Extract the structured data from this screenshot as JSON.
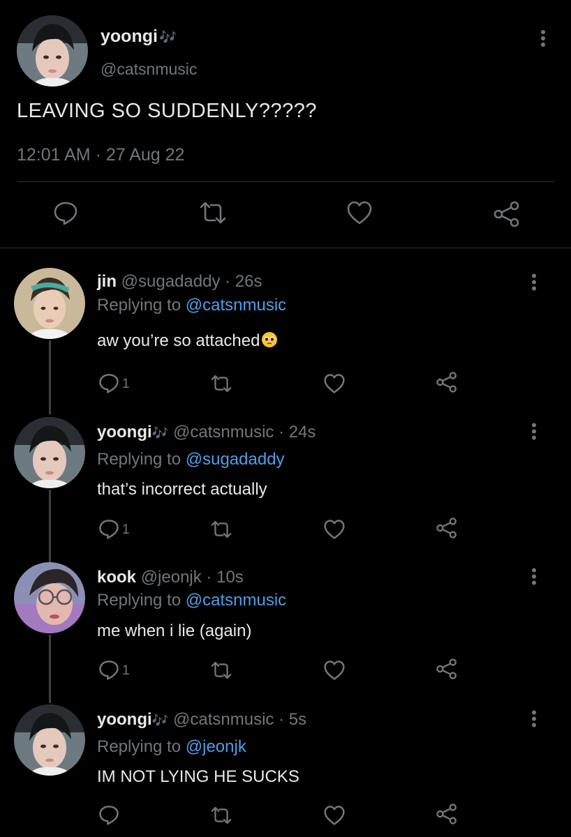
{
  "main_tweet": {
    "name": "yoongi",
    "name_emoji": "🎶",
    "handle": "@catsnmusic",
    "text": "LEAVING SO SUDDENLY?????",
    "timestamp": "12:01 AM · 27 Aug 22",
    "actions": [
      "reply-icon",
      "retweet-icon",
      "like-icon",
      "share-icon"
    ]
  },
  "replies": [
    {
      "name": "jin",
      "name_emoji": "",
      "handle": "@sugadaddy",
      "time": " · 26s",
      "replying_prefix": "Replying to ",
      "replying_to": "@catsnmusic",
      "text": "aw you’re so attached",
      "text_emoji": "🥺",
      "reply_count": "1"
    },
    {
      "name": "yoongi",
      "name_emoji": "🎶",
      "handle": "@catsnmusic",
      "time": " · 24s",
      "replying_prefix": "Replying to ",
      "replying_to": "@sugadaddy",
      "text": "that’s incorrect actually",
      "text_emoji": "",
      "reply_count": "1"
    },
    {
      "name": "kook",
      "name_emoji": "",
      "handle": "@jeonjk",
      "time": " · 10s",
      "replying_prefix": "Replying to ",
      "replying_to": "@catsnmusic",
      "text": "me when i lie (again)",
      "text_emoji": "",
      "reply_count": "1"
    },
    {
      "name": "yoongi",
      "name_emoji": "🎶",
      "handle": "@catsnmusic",
      "time": " · 5s",
      "replying_prefix": "Replying to ",
      "replying_to": "@jeonjk",
      "text": "IM NOT LYING HE SUCKS",
      "text_emoji": "",
      "reply_count": ""
    }
  ],
  "colors": {
    "background": "#000000",
    "text": "#e7e9ea",
    "secondary": "#71767b",
    "mention": "#4f9ee8",
    "divider": "#2f3336"
  }
}
